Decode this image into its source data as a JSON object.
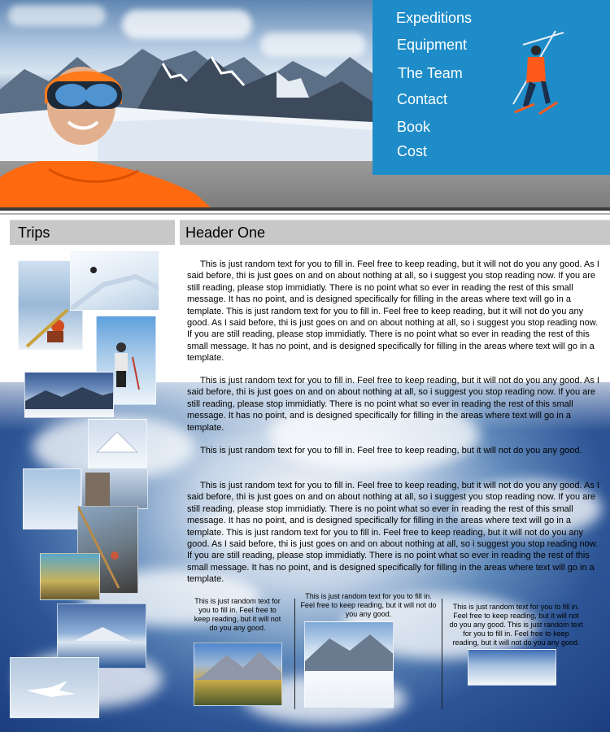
{
  "nav": {
    "items": [
      "Expeditions",
      "Equipment",
      "The Team",
      "Contact",
      "Book",
      "Cost"
    ]
  },
  "sidebar": {
    "title": "Trips"
  },
  "main": {
    "header": "Header One",
    "paragraphs": [
      "This is just random text for you to fill in.  Feel free to keep reading, but it will not do you any good.  As I said before, thi is just goes on and on about nothing at all, so i suggest you stop reading now.  If you are still reading, please stop immidiatly.  There is no point what so ever in reading the rest of this small message.  It has no point, and is designed specifically for filling in the areas where text will go in a template.  This is just random text for you to fill in.  Feel free to keep reading, but it will not do you any good.  As I said before, thi is just goes on and on about nothing at all, so i suggest you stop reading now.  If you are still reading, please stop immidiatly.  There is no point what so ever in reading the rest of this small message.  It has no point, and is designed specifically for filling in the areas where text will go in a template.",
      "This is just random text for you to fill in.  Feel free to keep reading, but it will not do you any good.  As I said before, thi is just goes on and on about nothing at all, so i suggest you stop reading now.  If you are still reading, please stop immidiatly.  There is no point what so ever in reading the rest of this small message.  It has no point, and is designed specifically for filling in the areas where text will go in a template.",
      "This is just random text for you to fill in.  Feel free to keep reading, but it will not do you any good.",
      "This is just random text for you to fill in.  Feel free to keep reading, but it will not do you any good.  As I said before, thi is just goes on and on about nothing at all, so i suggest you stop reading now.  If you are still reading, please stop immidiatly.  There is no point what so ever in reading the rest of this small message.  It has no point, and is designed specifically for filling in the areas where text will go in a template.  This is just random text for you to fill in.  Feel free to keep reading, but it will not do you any good.  As I said before, thi is just goes on and on about nothing at all, so i suggest you stop reading now.  If you are still reading, please stop immidiatly.  There is no point what so ever in reading the rest of this small message.  It has no point, and is designed specifically for filling in the areas where text will go in a template."
    ],
    "columns": [
      "This is just random text for you to fill in.  Feel free to keep reading, but it will not do you any good.",
      "This is just random text for you to fill in.  Feel free to keep reading, but it will not do you any good.",
      "This is just random text for you to fill in.  Feel free to keep reading, but it will not do you any good. This is just random text for you to fill in.  Feel free to keep reading, but it will not do you any good."
    ]
  },
  "colors": {
    "nav_bg": "#1e8cc8",
    "section_bar": "#c8c8c8",
    "header_band": "#8a8a8a"
  }
}
